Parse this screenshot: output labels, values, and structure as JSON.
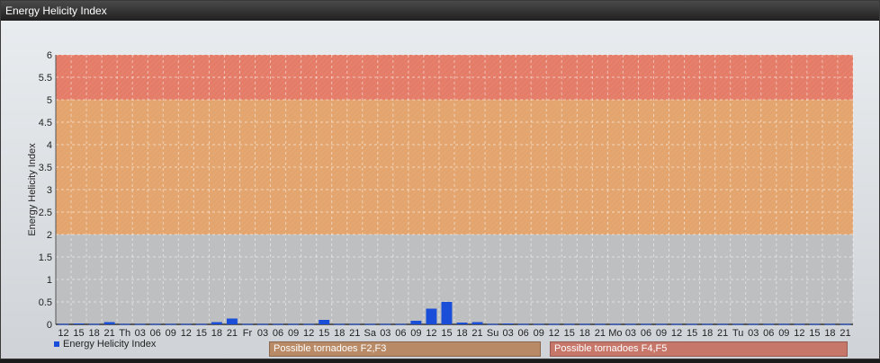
{
  "window": {
    "title": "Energy Helicity Index"
  },
  "colors": {
    "bar": "#1a4ed8",
    "band_low": "#bdbfc1",
    "band_mid": "#e3a46d",
    "band_high": "#e47c68",
    "label_mid": "#b98a66",
    "label_high": "#c7776a"
  },
  "bands": [
    {
      "label": "Possible tornadoes F2,F3",
      "from": 2,
      "to": 5
    },
    {
      "label": "Possible tornadoes F4,F5",
      "from": 5,
      "to": 6
    }
  ],
  "legend": {
    "label": "Energy Helicity Index"
  },
  "chart_data": {
    "type": "bar",
    "ylabel": "Energy Helicity Index",
    "ylim": [
      0,
      6
    ],
    "yticks": [
      "0",
      "0.5",
      "1",
      "1.5",
      "2",
      "2.5",
      "3",
      "3.5",
      "4",
      "4.5",
      "5",
      "5.5",
      "6"
    ],
    "grid": true,
    "legend_position": "bottom-left",
    "categories": [
      "12",
      "15",
      "18",
      "21",
      "Th",
      "03",
      "06",
      "09",
      "12",
      "15",
      "18",
      "21",
      "Fr",
      "03",
      "06",
      "09",
      "12",
      "15",
      "18",
      "21",
      "Sa",
      "03",
      "06",
      "09",
      "12",
      "15",
      "18",
      "21",
      "Su",
      "03",
      "06",
      "09",
      "12",
      "15",
      "18",
      "21",
      "Mo",
      "03",
      "06",
      "09",
      "12",
      "15",
      "18",
      "21",
      "Tu",
      "03",
      "06",
      "09",
      "12",
      "15",
      "18",
      "21"
    ],
    "series": [
      {
        "name": "Energy Helicity Index",
        "values": [
          0.01,
          0.02,
          0.01,
          0.05,
          0.01,
          0.01,
          0.01,
          0.01,
          0.01,
          0.01,
          0.05,
          0.13,
          0.01,
          0.01,
          0.01,
          0.01,
          0.01,
          0.1,
          0.01,
          0.01,
          0.01,
          0.01,
          0.01,
          0.08,
          0.35,
          0.5,
          0.04,
          0.05,
          0.01,
          0.02,
          0.01,
          0.01,
          0.01,
          0.01,
          0.01,
          0.01,
          0.01,
          0.01,
          0.01,
          0.01,
          0.01,
          0.01,
          0.01,
          0.01,
          0.01,
          0.01,
          0.01,
          0.01,
          0.01,
          0.01,
          0.01,
          0.01
        ]
      }
    ]
  }
}
